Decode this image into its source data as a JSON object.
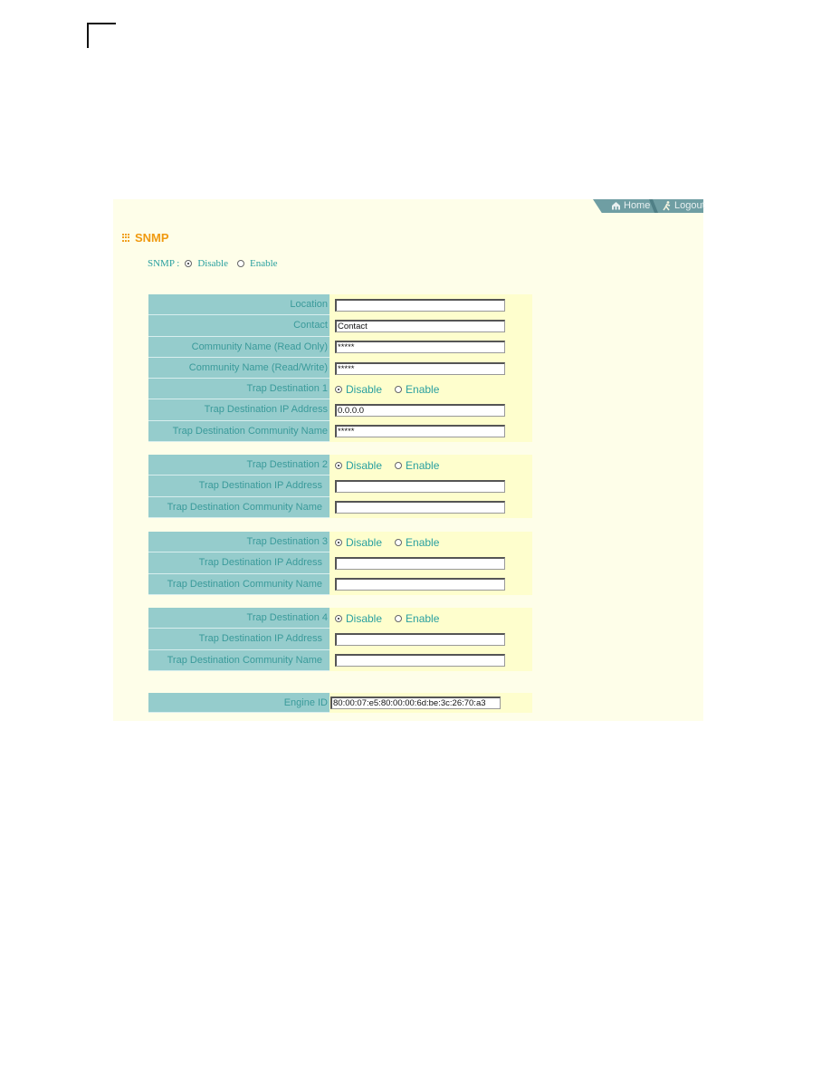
{
  "header": {
    "home_label": "Home",
    "logout_label": "Logout"
  },
  "page_title": "SNMP",
  "snmp": {
    "label": "SNMP :",
    "options": [
      "Disable",
      "Enable"
    ],
    "selected": "Disable"
  },
  "general": {
    "location": {
      "label": "Location",
      "value": ""
    },
    "contact": {
      "label": "Contact",
      "value": "Contact"
    },
    "community_ro": {
      "label": "Community Name (Read Only)",
      "value": "*****"
    },
    "community_rw": {
      "label": "Community Name (Read/Write)",
      "value": "*****"
    }
  },
  "traps": [
    {
      "label": "Trap Destination 1",
      "options": [
        "Disable",
        "Enable"
      ],
      "selected": "Disable",
      "ip_label": "Trap Destination IP Address",
      "ip_value": "0.0.0.0",
      "community_label": "Trap Destination Community Name",
      "community_value": "*****"
    },
    {
      "label": "Trap Destination 2",
      "options": [
        "Disable",
        "Enable"
      ],
      "selected": "Disable",
      "ip_label": "Trap Destination IP Address",
      "ip_value": "",
      "community_label": "Trap Destination Community Name",
      "community_value": ""
    },
    {
      "label": "Trap Destination 3",
      "options": [
        "Disable",
        "Enable"
      ],
      "selected": "Disable",
      "ip_label": "Trap Destination IP Address",
      "ip_value": "",
      "community_label": "Trap Destination Community Name",
      "community_value": ""
    },
    {
      "label": "Trap Destination 4",
      "options": [
        "Disable",
        "Enable"
      ],
      "selected": "Disable",
      "ip_label": "Trap Destination IP Address",
      "ip_value": "",
      "community_label": "Trap Destination Community Name",
      "community_value": ""
    }
  ],
  "engine": {
    "label": "Engine ID",
    "value": "80:00:07:e5:80:00:00:6d:be:3c:26:70:a3"
  }
}
